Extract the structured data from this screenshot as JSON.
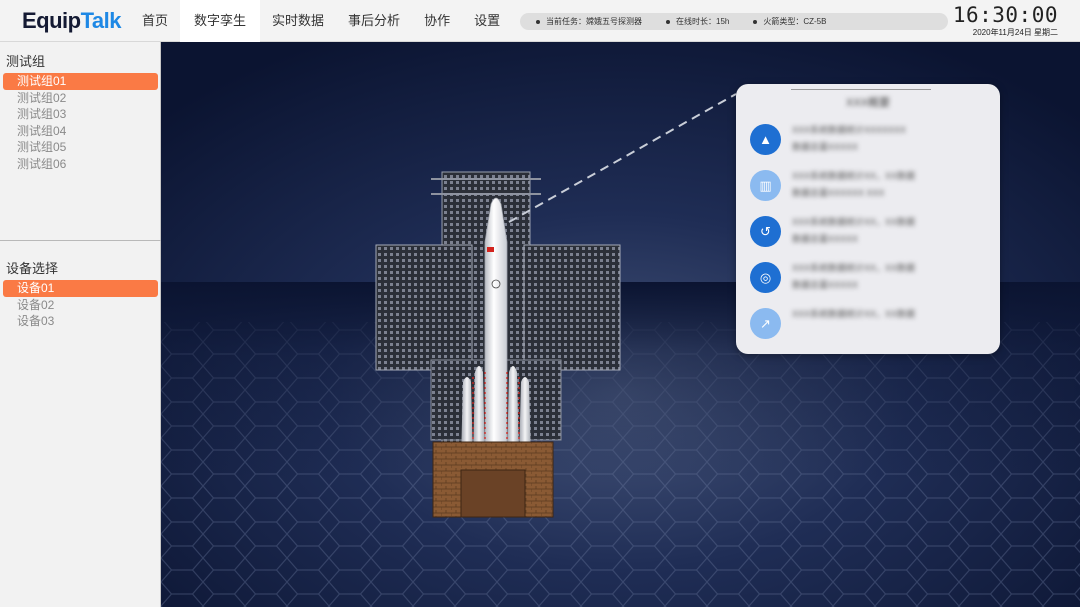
{
  "header": {
    "logo_main": "Equip",
    "logo_accent": "Talk",
    "nav": [
      {
        "label": "首页"
      },
      {
        "label": "数字孪生"
      },
      {
        "label": "实时数据"
      },
      {
        "label": "事后分析"
      },
      {
        "label": "协作"
      },
      {
        "label": "设置"
      }
    ],
    "active_nav": "数字孪生",
    "status": [
      {
        "label": "当前任务：嫦娥五号探测器"
      },
      {
        "label": "在线时长：15h"
      },
      {
        "label": "火箭类型：CZ-5B"
      }
    ],
    "time": "16:30:00",
    "date": "2020年11月24日 星期二"
  },
  "sidebar": {
    "group_title": "测试组",
    "groups": [
      {
        "label": "测试组01",
        "selected": true
      },
      {
        "label": "测试组02",
        "selected": false
      },
      {
        "label": "测试组03",
        "selected": false
      },
      {
        "label": "测试组04",
        "selected": false
      },
      {
        "label": "测试组05",
        "selected": false
      },
      {
        "label": "测试组06",
        "selected": false
      }
    ],
    "device_title": "设备选择",
    "devices": [
      {
        "label": "设备01",
        "selected": true
      },
      {
        "label": "设备02",
        "selected": false
      },
      {
        "label": "设备03",
        "selected": false
      }
    ]
  },
  "info_card": {
    "title": "XXX概要",
    "rows": [
      {
        "icon": "area-chart-icon",
        "glyph": "▲",
        "line1": "XXX系统数据统计XXXXXXX",
        "line2": "数据总量XXXXX"
      },
      {
        "icon": "bar-chart-icon",
        "glyph": "▥",
        "line1": "XXX系统数据统计XX，XX数据",
        "line2": "数据总量XXXXXX XXX"
      },
      {
        "icon": "history-icon",
        "glyph": "↺",
        "line1": "XXX系统数据统计XX，XX数据",
        "line2": "数据总量XXXXX"
      },
      {
        "icon": "coins-icon",
        "glyph": "◎",
        "line1": "XXX系统数据统计XX，XX数据",
        "line2": "数据总量XXXXX"
      },
      {
        "icon": "trend-chart-icon",
        "glyph": "↗",
        "line1": "XXX系统数据统计XX，XX数据",
        "line2": ""
      }
    ]
  },
  "colors": {
    "accent_orange": "#fa7a45",
    "icon_blue": "#1e6fd2",
    "icon_blue_light": "#8bbaf0",
    "logo_blue": "#1e88e5",
    "scene_background": "#0c1633"
  }
}
